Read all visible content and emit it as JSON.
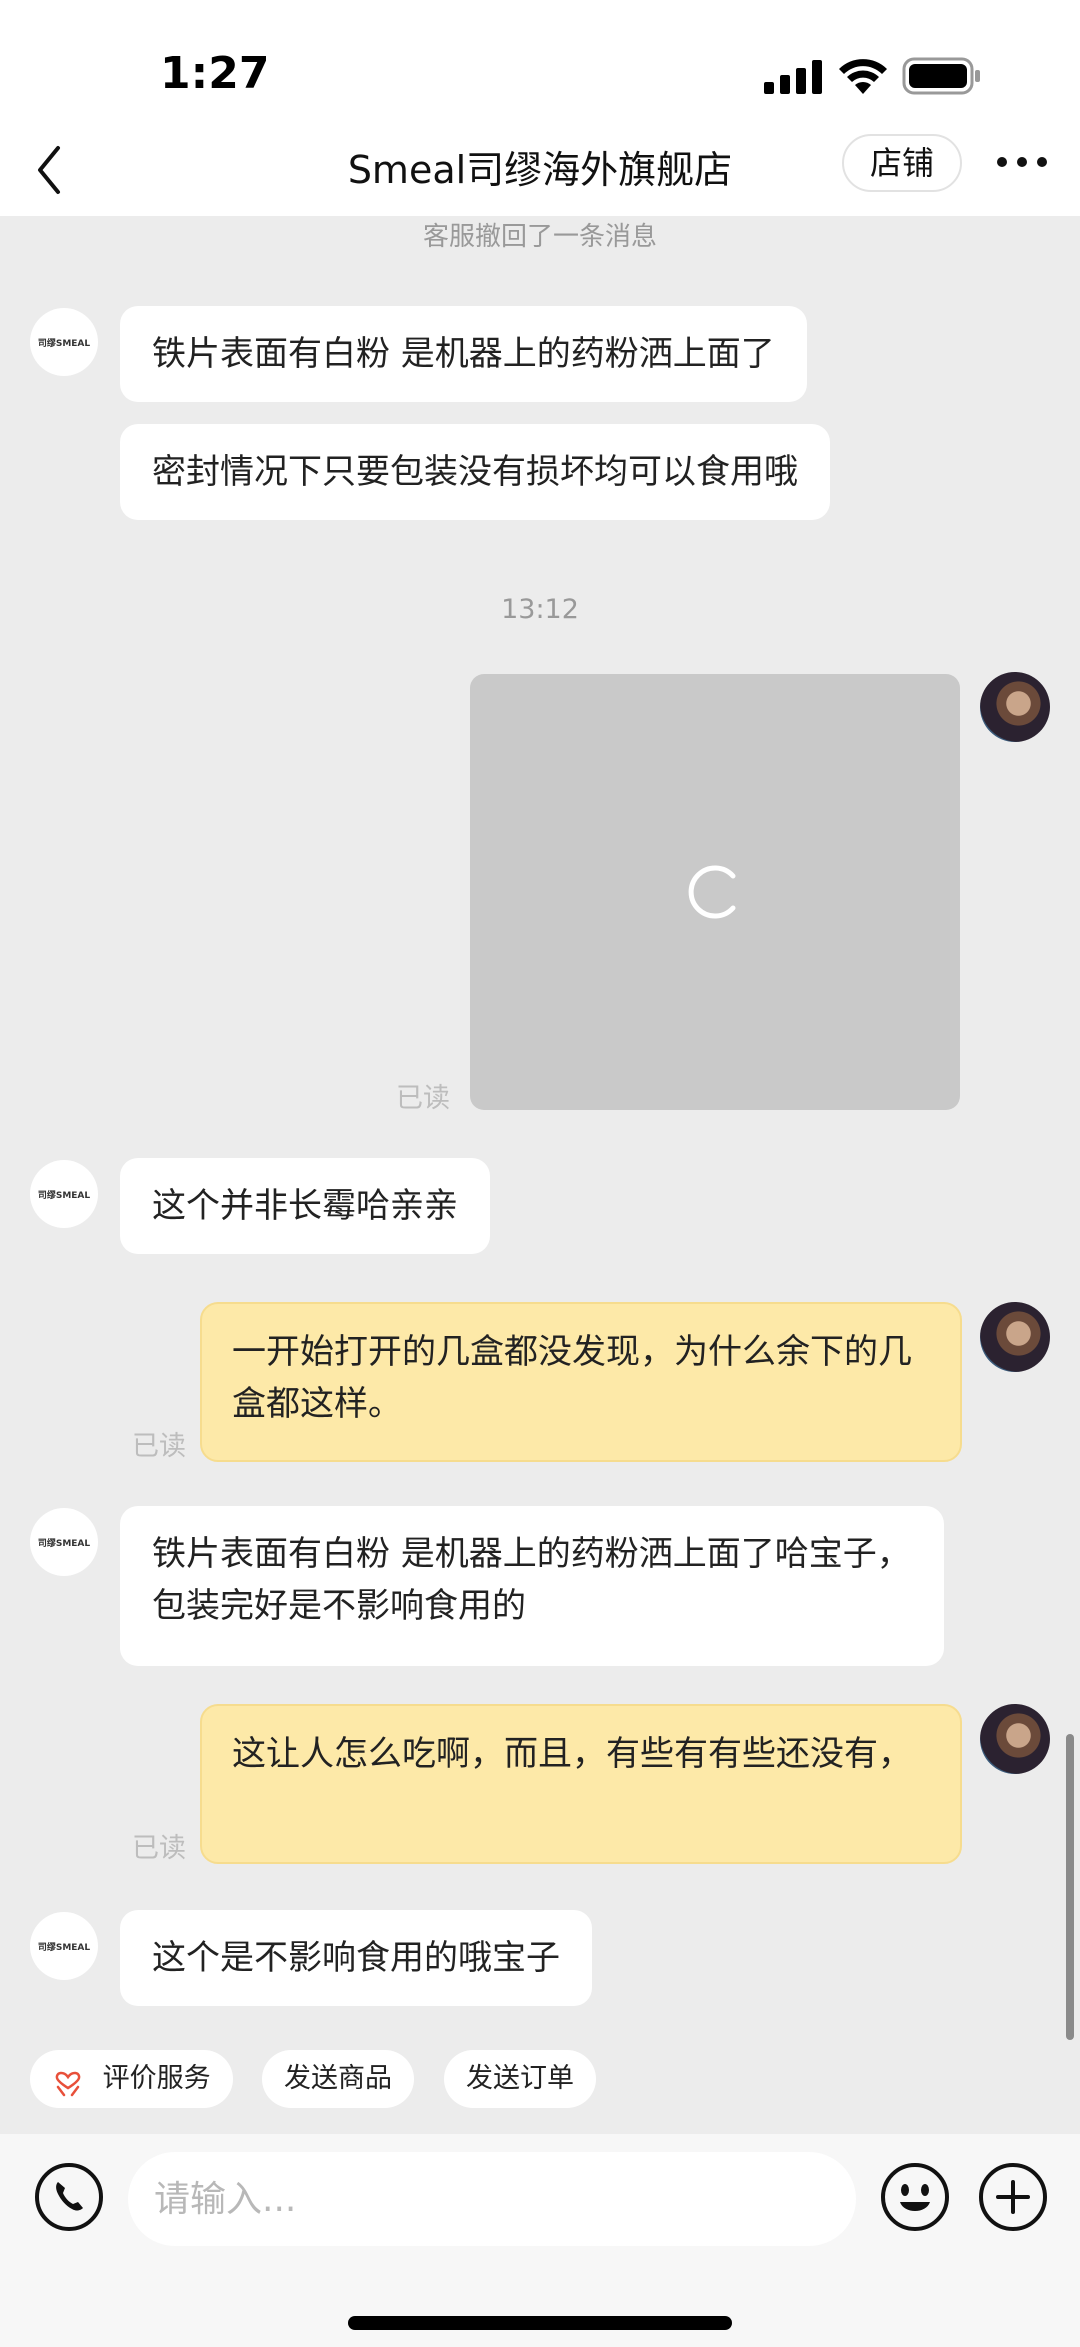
{
  "status_bar": {
    "time": "1:27"
  },
  "nav": {
    "title": "Smeal司缪海外旗舰店",
    "store_label": "店铺"
  },
  "shop_avatar_text": "司缪SMEAL",
  "messages": {
    "recalled_note": "客服撤回了一条消息",
    "m1": "铁片表面有白粉 是机器上的药粉洒上面了",
    "m2": "密封情况下只要包装没有损坏均可以食用哦",
    "timestamp": "13:12",
    "image_read": "已读",
    "m3": "这个并非长霉哈亲亲",
    "u1": "一开始打开的几盒都没发现，为什么余下的几盒都这样。",
    "u1_read": "已读",
    "m4": "铁片表面有白粉 是机器上的药粉洒上面了哈宝子，包装完好是不影响食用的",
    "u2": "这让人怎么吃啊，而且，有些有有些还没有，",
    "u2_read": "已读",
    "m5": "这个是不影响食用的哦宝子"
  },
  "quick_actions": {
    "rate_service": "评价服务",
    "send_product": "发送商品",
    "send_order": "发送订单"
  },
  "input": {
    "placeholder": "请输入..."
  },
  "colors": {
    "outgoing_bubble": "#fde9a8",
    "incoming_bubble": "#ffffff",
    "background": "#ececec",
    "accent": "#e8503a"
  }
}
